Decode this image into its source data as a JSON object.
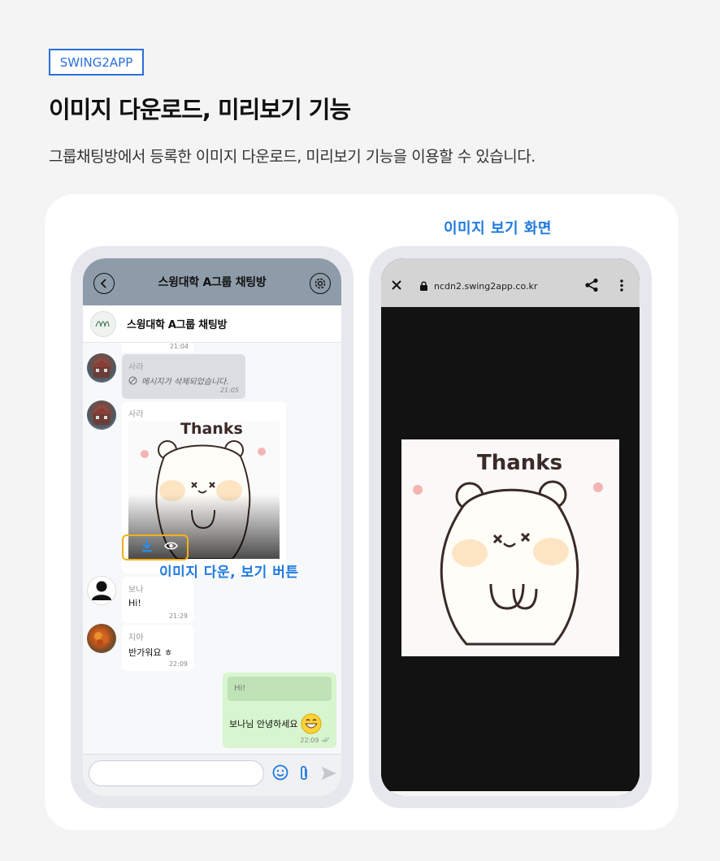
{
  "badge": "SWING2APP",
  "title": "이미지 다운로드, 미리보기 기능",
  "description": "그룹채팅방에서 등록한 이미지 다운로드, 미리보기 기능을 이용할 수 있습니다.",
  "right_label": "이미지 보기 화면",
  "annotation": "이미지 다운, 보기 버튼",
  "colors": {
    "accent": "#1f7ae0",
    "highlight": "#f5b015",
    "header": "#8e9caa",
    "my_bubble": "#d7f5ce"
  },
  "chat": {
    "header_title": "스윙대학 A그룹 채팅방",
    "room_name": "스윙대학 A그룹 채팅방",
    "top_time": "21:04",
    "messages": [
      {
        "sender": "사라",
        "text": "메시지가 삭제되었습니다.",
        "time": "21:05"
      },
      {
        "sender": "사라",
        "image_text": "Thanks"
      },
      {
        "sender": "보나",
        "text": "Hi!",
        "time": "21:29"
      },
      {
        "sender": "지아",
        "text": "반가워요 ㅎ",
        "time": "22:09"
      }
    ],
    "mine": {
      "quote": "Hi!",
      "text": "보나님 안녕하세요",
      "time": "22:09"
    }
  },
  "viewer": {
    "url": "ncdn2.swing2app.co.kr",
    "image_text": "Thanks"
  }
}
